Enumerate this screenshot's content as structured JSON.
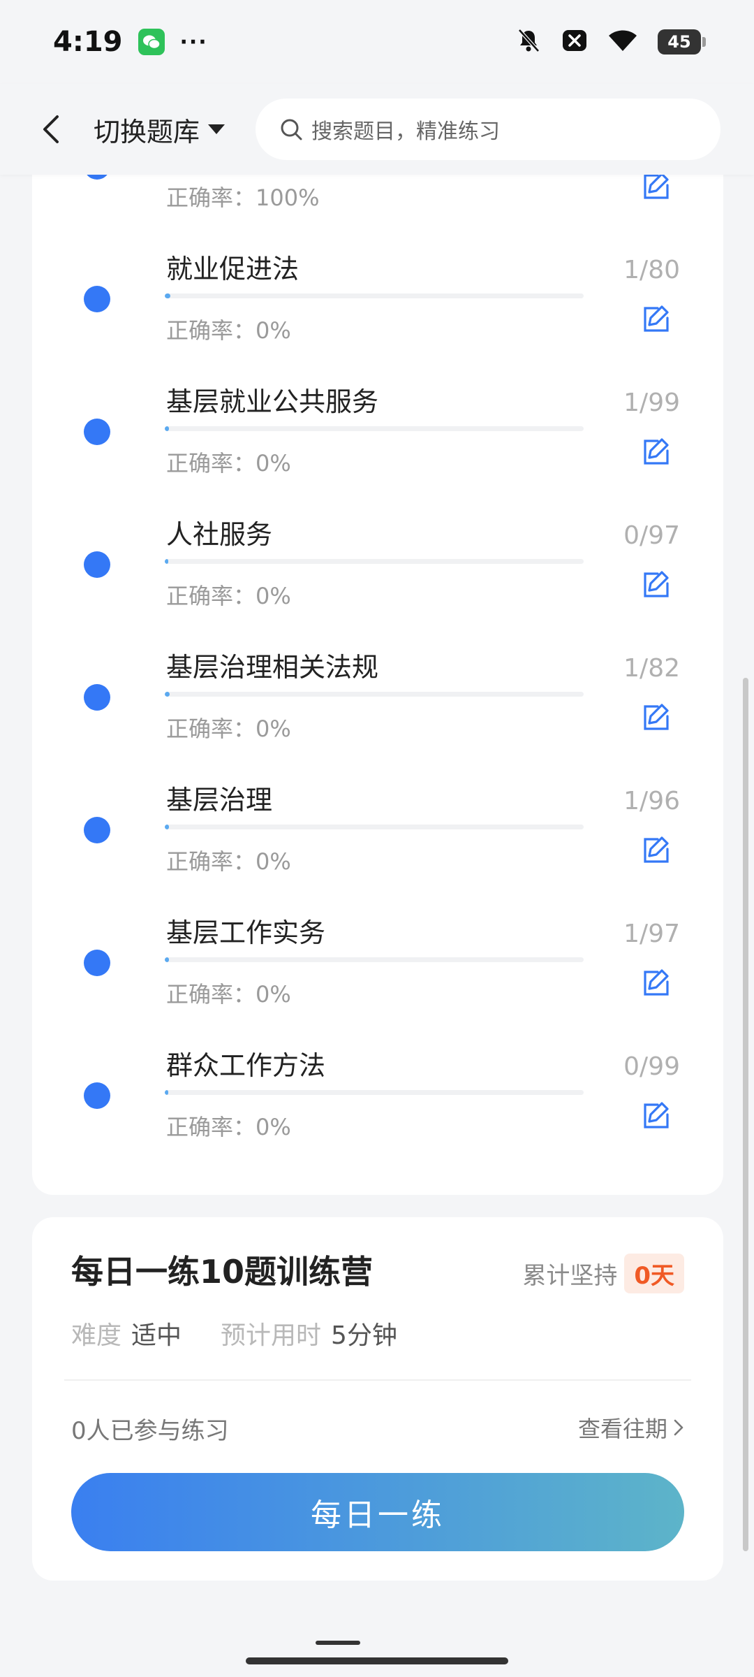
{
  "status_bar": {
    "time": "4:19",
    "dots": "···",
    "battery": "45"
  },
  "header": {
    "bank_switch_label": "切换题库",
    "search_placeholder": "搜索题目，精准练习"
  },
  "topics": [
    {
      "title": "",
      "accuracy": "正确率：100%",
      "count": "",
      "progress": 0.01
    },
    {
      "title": "就业促进法",
      "accuracy": "正确率：0%",
      "count": "1/80",
      "progress": 0.0125
    },
    {
      "title": "基层就业公共服务",
      "accuracy": "正确率：0%",
      "count": "1/99",
      "progress": 0.0101
    },
    {
      "title": "人社服务",
      "accuracy": "正确率：0%",
      "count": "0/97",
      "progress": 0.0
    },
    {
      "title": "基层治理相关法规",
      "accuracy": "正确率：0%",
      "count": "1/82",
      "progress": 0.0122
    },
    {
      "title": "基层治理",
      "accuracy": "正确率：0%",
      "count": "1/96",
      "progress": 0.0104
    },
    {
      "title": "基层工作实务",
      "accuracy": "正确率：0%",
      "count": "1/97",
      "progress": 0.0103
    },
    {
      "title": "群众工作方法",
      "accuracy": "正确率：0%",
      "count": "0/99",
      "progress": 0.0
    }
  ],
  "camp": {
    "title": "每日一练10题训练营",
    "streak_label": "累计坚持",
    "streak_value": "0天",
    "difficulty_label": "难度",
    "difficulty_value": "适中",
    "time_label": "预计用时",
    "time_value": "5分钟",
    "participants": "0人已参与练习",
    "history_link": "查看往期",
    "button_label": "每日一练"
  },
  "colors": {
    "accent": "#3478f6",
    "streak": "#f05a25",
    "progress": "#5aa9f0"
  }
}
